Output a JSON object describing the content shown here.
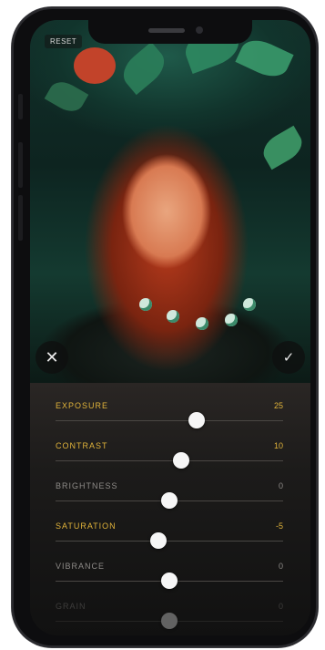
{
  "toolbar": {
    "reset_label": "RESET"
  },
  "actions": {
    "cancel_icon": "close-icon",
    "confirm_icon": "check-icon"
  },
  "adjustments": [
    {
      "label": "EXPOSURE",
      "value": "25",
      "active": true,
      "slider": 0.62
    },
    {
      "label": "CONTRAST",
      "value": "10",
      "active": true,
      "slider": 0.55
    },
    {
      "label": "BRIGHTNESS",
      "value": "0",
      "active": false,
      "slider": 0.5
    },
    {
      "label": "SATURATION",
      "value": "-5",
      "active": true,
      "slider": 0.45
    },
    {
      "label": "VIBRANCE",
      "value": "0",
      "active": false,
      "slider": 0.5
    },
    {
      "label": "GRAIN",
      "value": "0",
      "active": false,
      "slider": 0.5
    }
  ],
  "colors": {
    "active": "#e0b33a",
    "inactive": "#8e8b88",
    "knob": "#f6f6f6"
  }
}
